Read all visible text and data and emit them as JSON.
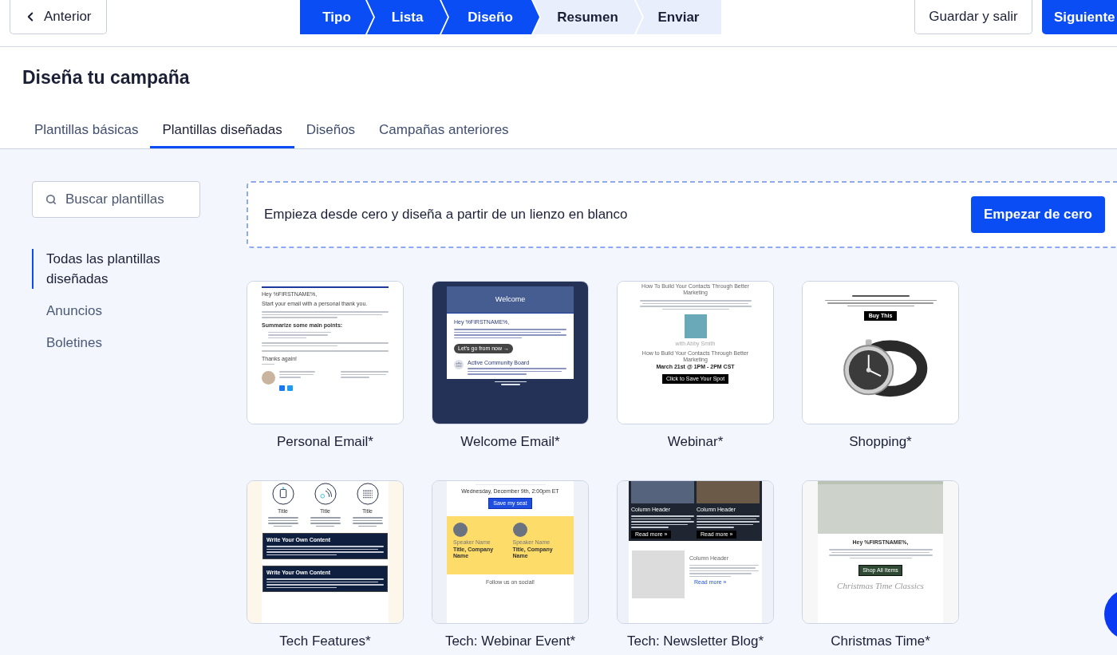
{
  "nav": {
    "back": "Anterior",
    "steps": [
      {
        "label": "Tipo",
        "active": true
      },
      {
        "label": "Lista",
        "active": true
      },
      {
        "label": "Diseño",
        "active": true
      },
      {
        "label": "Resumen",
        "active": false
      },
      {
        "label": "Enviar",
        "active": false
      }
    ],
    "save": "Guardar y salir",
    "next": "Siguiente"
  },
  "page_title": "Diseña tu campaña",
  "tabs": [
    {
      "label": "Plantillas básicas",
      "selected": false
    },
    {
      "label": "Plantillas diseñadas",
      "selected": true
    },
    {
      "label": "Diseños",
      "selected": false
    },
    {
      "label": "Campañas anteriores",
      "selected": false
    }
  ],
  "search": {
    "placeholder": "Buscar plantillas"
  },
  "categories": [
    {
      "label": "Todas las plantillas diseñadas",
      "selected": true
    },
    {
      "label": "Anuncios",
      "selected": false
    },
    {
      "label": "Boletines",
      "selected": false
    }
  ],
  "blank_start": {
    "text": "Empieza desde cero y diseña a partir de un lienzo en blanco",
    "button": "Empezar de cero"
  },
  "templates": [
    {
      "name": "Personal Email*",
      "kind": "personal",
      "preview": {
        "greeting": "Hey %FIRSTNAME%,",
        "intro": "Start your email with a personal thank you.",
        "points_heading": "Summarize some main points:",
        "closing": "Thanks again!"
      }
    },
    {
      "name": "Welcome Email*",
      "kind": "welcome",
      "preview": {
        "banner": "Welcome",
        "greeting": "Hey %FIRSTNAME%,",
        "button": "Let's go from now →",
        "feature": "Active Community Board"
      }
    },
    {
      "name": "Webinar*",
      "kind": "webinar",
      "preview": {
        "title": "How To Build Your Contacts Through Better Marketing",
        "host": "with Abby Smith",
        "subtitle": "How to Build Your Contacts Through Better Marketing",
        "date": "March 21st @ 1PM - 2PM CST",
        "button": "Click to Save Your Spot"
      }
    },
    {
      "name": "Shopping*",
      "kind": "shopping",
      "preview": {
        "button": "Buy This"
      }
    },
    {
      "name": "Tech Features*",
      "kind": "features",
      "preview": {
        "columns": [
          "Title",
          "Title",
          "Title"
        ],
        "blocks": [
          "Write Your Own Content",
          "Write Your Own Content"
        ]
      }
    },
    {
      "name": "Tech: Webinar Event*",
      "kind": "event",
      "preview": {
        "date": "Wednesday, December 9th, 2:00pm ET",
        "button": "Save my seat",
        "speakers": [
          {
            "name": "Speaker Name",
            "title": "Title, Company Name"
          },
          {
            "name": "Speaker Name",
            "title": "Title, Company Name"
          }
        ],
        "footer": "Follow us on social!"
      }
    },
    {
      "name": "Tech: Newsletter Blog*",
      "kind": "newsletter",
      "preview": {
        "columns": [
          {
            "header": "Column Header",
            "button": "Read more »"
          },
          {
            "header": "Column Header",
            "button": "Read more »"
          }
        ],
        "feature": {
          "header": "Column Header",
          "link": "Read more »"
        }
      }
    },
    {
      "name": "Christmas Time*",
      "kind": "christmas",
      "preview": {
        "greeting": "Hey %FIRSTNAME%,",
        "button": "Shop All Items",
        "signature": "Christmas Time Classics"
      }
    }
  ]
}
